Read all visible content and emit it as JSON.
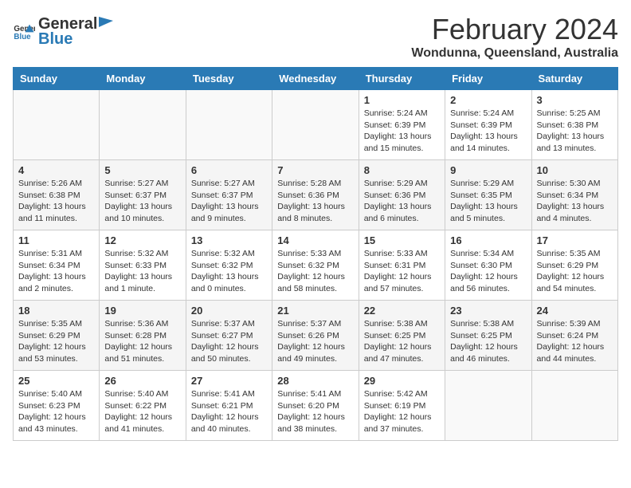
{
  "header": {
    "logo": {
      "general": "General",
      "blue": "Blue"
    },
    "title": "February 2024",
    "subtitle": "Wondunna, Queensland, Australia"
  },
  "calendar": {
    "weekdays": [
      "Sunday",
      "Monday",
      "Tuesday",
      "Wednesday",
      "Thursday",
      "Friday",
      "Saturday"
    ],
    "weeks": [
      [
        {
          "day": "",
          "info": ""
        },
        {
          "day": "",
          "info": ""
        },
        {
          "day": "",
          "info": ""
        },
        {
          "day": "",
          "info": ""
        },
        {
          "day": "1",
          "info": "Sunrise: 5:24 AM\nSunset: 6:39 PM\nDaylight: 13 hours\nand 15 minutes."
        },
        {
          "day": "2",
          "info": "Sunrise: 5:24 AM\nSunset: 6:39 PM\nDaylight: 13 hours\nand 14 minutes."
        },
        {
          "day": "3",
          "info": "Sunrise: 5:25 AM\nSunset: 6:38 PM\nDaylight: 13 hours\nand 13 minutes."
        }
      ],
      [
        {
          "day": "4",
          "info": "Sunrise: 5:26 AM\nSunset: 6:38 PM\nDaylight: 13 hours\nand 11 minutes."
        },
        {
          "day": "5",
          "info": "Sunrise: 5:27 AM\nSunset: 6:37 PM\nDaylight: 13 hours\nand 10 minutes."
        },
        {
          "day": "6",
          "info": "Sunrise: 5:27 AM\nSunset: 6:37 PM\nDaylight: 13 hours\nand 9 minutes."
        },
        {
          "day": "7",
          "info": "Sunrise: 5:28 AM\nSunset: 6:36 PM\nDaylight: 13 hours\nand 8 minutes."
        },
        {
          "day": "8",
          "info": "Sunrise: 5:29 AM\nSunset: 6:36 PM\nDaylight: 13 hours\nand 6 minutes."
        },
        {
          "day": "9",
          "info": "Sunrise: 5:29 AM\nSunset: 6:35 PM\nDaylight: 13 hours\nand 5 minutes."
        },
        {
          "day": "10",
          "info": "Sunrise: 5:30 AM\nSunset: 6:34 PM\nDaylight: 13 hours\nand 4 minutes."
        }
      ],
      [
        {
          "day": "11",
          "info": "Sunrise: 5:31 AM\nSunset: 6:34 PM\nDaylight: 13 hours\nand 2 minutes."
        },
        {
          "day": "12",
          "info": "Sunrise: 5:32 AM\nSunset: 6:33 PM\nDaylight: 13 hours\nand 1 minute."
        },
        {
          "day": "13",
          "info": "Sunrise: 5:32 AM\nSunset: 6:32 PM\nDaylight: 13 hours\nand 0 minutes."
        },
        {
          "day": "14",
          "info": "Sunrise: 5:33 AM\nSunset: 6:32 PM\nDaylight: 12 hours\nand 58 minutes."
        },
        {
          "day": "15",
          "info": "Sunrise: 5:33 AM\nSunset: 6:31 PM\nDaylight: 12 hours\nand 57 minutes."
        },
        {
          "day": "16",
          "info": "Sunrise: 5:34 AM\nSunset: 6:30 PM\nDaylight: 12 hours\nand 56 minutes."
        },
        {
          "day": "17",
          "info": "Sunrise: 5:35 AM\nSunset: 6:29 PM\nDaylight: 12 hours\nand 54 minutes."
        }
      ],
      [
        {
          "day": "18",
          "info": "Sunrise: 5:35 AM\nSunset: 6:29 PM\nDaylight: 12 hours\nand 53 minutes."
        },
        {
          "day": "19",
          "info": "Sunrise: 5:36 AM\nSunset: 6:28 PM\nDaylight: 12 hours\nand 51 minutes."
        },
        {
          "day": "20",
          "info": "Sunrise: 5:37 AM\nSunset: 6:27 PM\nDaylight: 12 hours\nand 50 minutes."
        },
        {
          "day": "21",
          "info": "Sunrise: 5:37 AM\nSunset: 6:26 PM\nDaylight: 12 hours\nand 49 minutes."
        },
        {
          "day": "22",
          "info": "Sunrise: 5:38 AM\nSunset: 6:25 PM\nDaylight: 12 hours\nand 47 minutes."
        },
        {
          "day": "23",
          "info": "Sunrise: 5:38 AM\nSunset: 6:25 PM\nDaylight: 12 hours\nand 46 minutes."
        },
        {
          "day": "24",
          "info": "Sunrise: 5:39 AM\nSunset: 6:24 PM\nDaylight: 12 hours\nand 44 minutes."
        }
      ],
      [
        {
          "day": "25",
          "info": "Sunrise: 5:40 AM\nSunset: 6:23 PM\nDaylight: 12 hours\nand 43 minutes."
        },
        {
          "day": "26",
          "info": "Sunrise: 5:40 AM\nSunset: 6:22 PM\nDaylight: 12 hours\nand 41 minutes."
        },
        {
          "day": "27",
          "info": "Sunrise: 5:41 AM\nSunset: 6:21 PM\nDaylight: 12 hours\nand 40 minutes."
        },
        {
          "day": "28",
          "info": "Sunrise: 5:41 AM\nSunset: 6:20 PM\nDaylight: 12 hours\nand 38 minutes."
        },
        {
          "day": "29",
          "info": "Sunrise: 5:42 AM\nSunset: 6:19 PM\nDaylight: 12 hours\nand 37 minutes."
        },
        {
          "day": "",
          "info": ""
        },
        {
          "day": "",
          "info": ""
        }
      ]
    ]
  }
}
